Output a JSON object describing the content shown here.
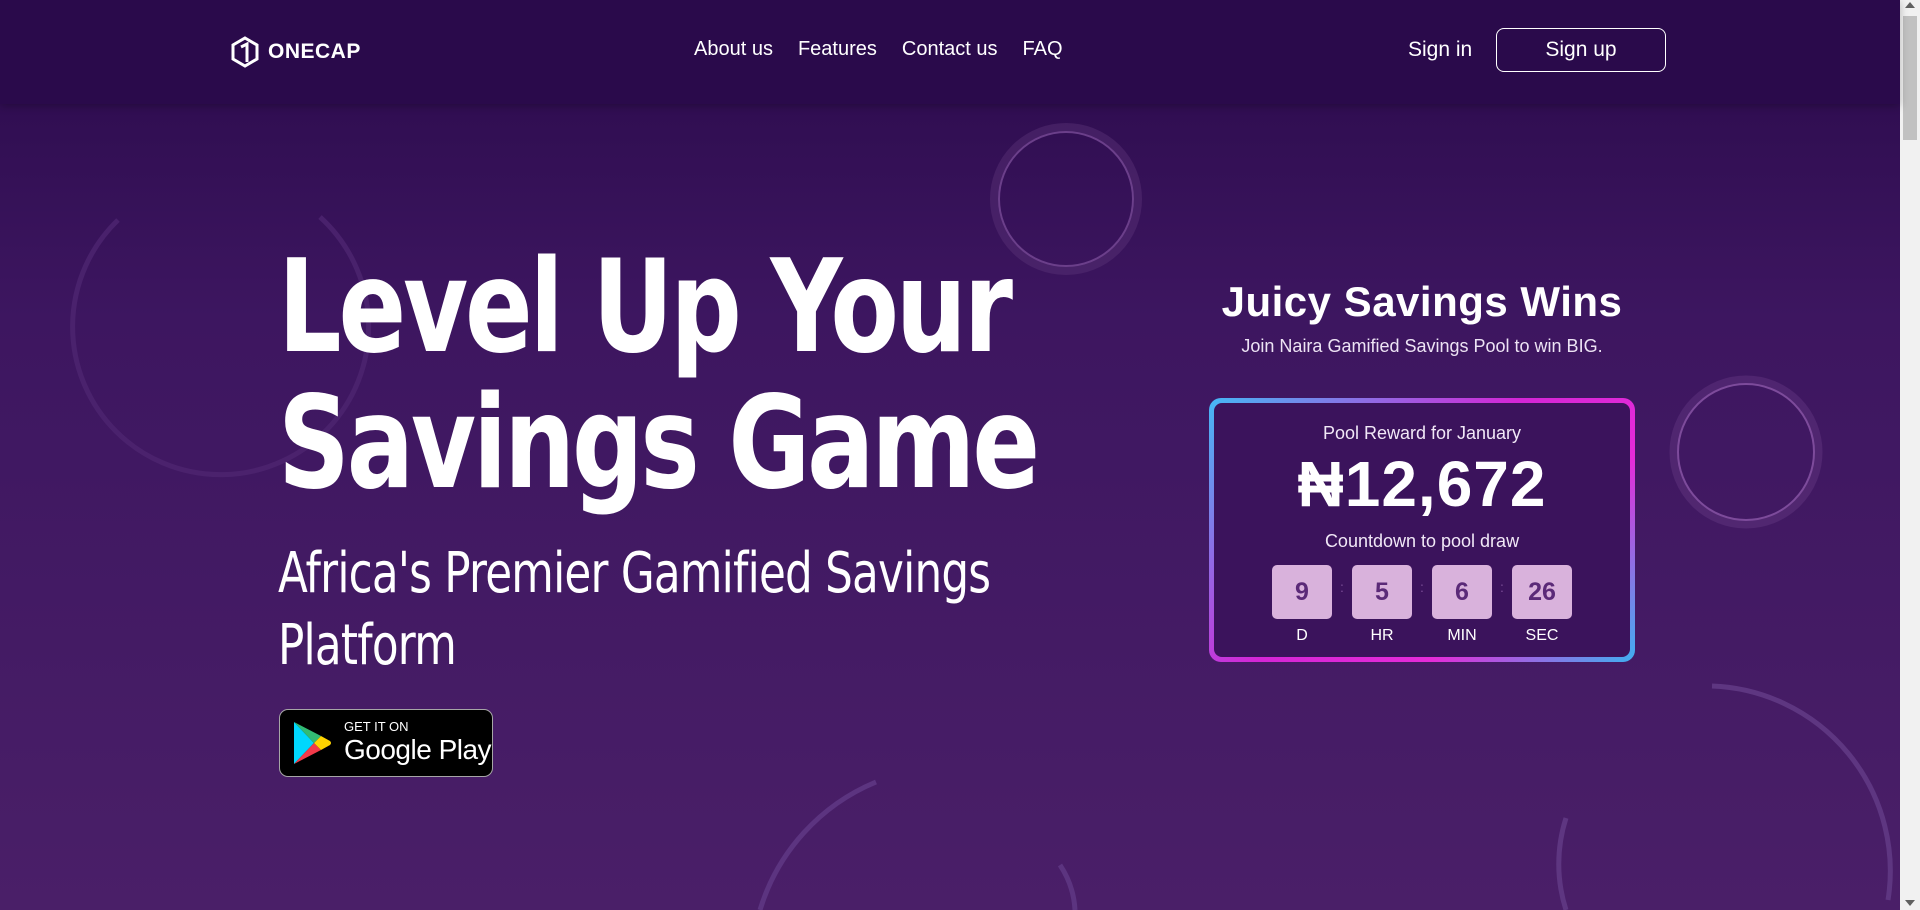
{
  "header": {
    "logo_text": "ONECAP",
    "nav": [
      "About us",
      "Features",
      "Contact us",
      "FAQ"
    ],
    "sign_in": "Sign in",
    "sign_up": "Sign up"
  },
  "hero": {
    "title_line1": "Level Up Your",
    "title_line2": "Savings Game",
    "subtitle_line1": "Africa's Premier Gamified Savings",
    "subtitle_line2": "Platform",
    "store_badge": {
      "small": "GET IT ON",
      "big": "Google Play"
    }
  },
  "promo": {
    "title": "Juicy Savings Wins",
    "subtitle": "Join Naira Gamified Savings Pool to win BIG.",
    "pool_label": "Pool Reward for January",
    "pool_amount": "₦12,672",
    "countdown_label": "Countdown to pool draw",
    "countdown": [
      {
        "value": "9",
        "unit": "D"
      },
      {
        "value": "5",
        "unit": "HR"
      },
      {
        "value": "6",
        "unit": "MIN"
      },
      {
        "value": "26",
        "unit": "SEC"
      }
    ]
  },
  "colors": {
    "background_top": "#2a0a4b",
    "background_bottom": "#4a1f68",
    "card_border_pink": "#e52bd8",
    "card_border_blue": "#45b8f5",
    "countdown_box": "#d9b2dc"
  }
}
